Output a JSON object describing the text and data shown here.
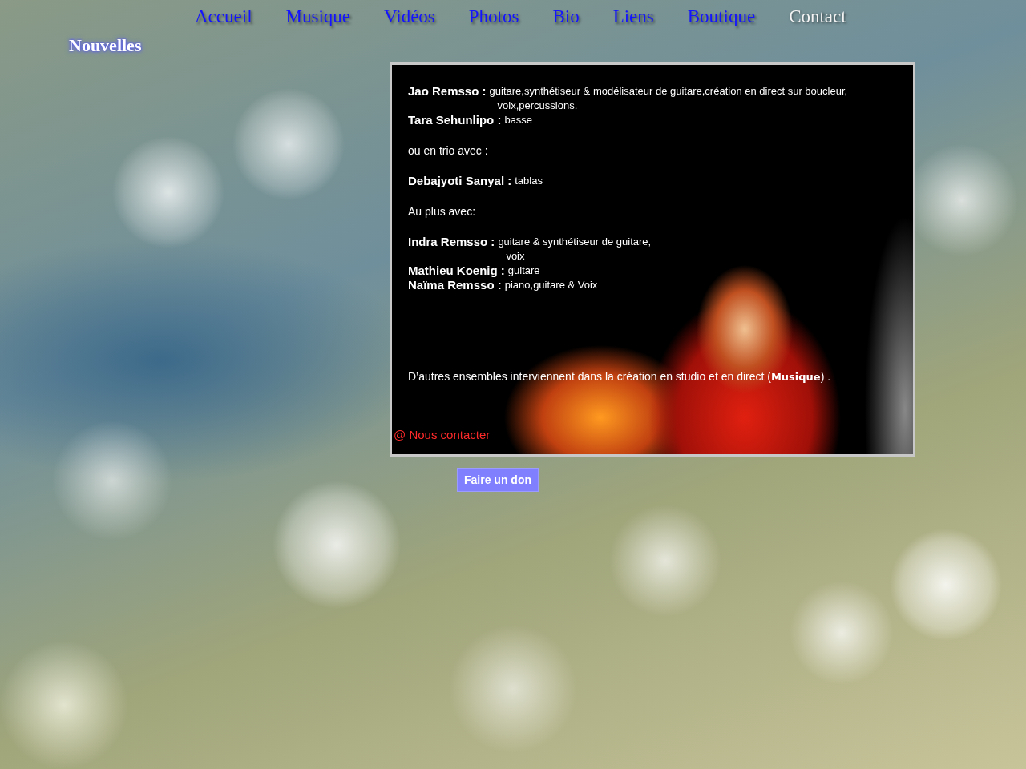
{
  "nav": [
    {
      "label": "Accueil",
      "selected": false
    },
    {
      "label": "Musique",
      "selected": false
    },
    {
      "label": "Vidéos",
      "selected": false
    },
    {
      "label": "Photos",
      "selected": false
    },
    {
      "label": "Bio",
      "selected": false
    },
    {
      "label": "Liens",
      "selected": false
    },
    {
      "label": "Boutique",
      "selected": false
    },
    {
      "label": "Contact",
      "selected": true
    }
  ],
  "heading": "Nouvelles",
  "card": {
    "blocks": [
      {
        "kind": "member",
        "name": "Jao Remsso :",
        "role_lines": [
          "guitare,synthétiseur &  modélisateur de guitare,création en direct sur boucleur,",
          "voix,percussions."
        ]
      },
      {
        "kind": "member",
        "name": "Tara Sehunlipo :",
        "role_lines": [
          "basse"
        ]
      },
      {
        "kind": "text",
        "text": "ou en trio avec :"
      },
      {
        "kind": "member",
        "name": "Debajyoti Sanyal :",
        "role_lines": [
          "tablas"
        ]
      },
      {
        "kind": "text",
        "text": "Au plus avec:"
      },
      {
        "kind": "member",
        "name": "Indra Remsso :",
        "role_lines": [
          "guitare & synthétiseur de guitare,",
          "voix"
        ]
      },
      {
        "kind": "member",
        "name": "Mathieu Koenig :",
        "role_lines": [
          "guitare"
        ]
      },
      {
        "kind": "member",
        "name": "Naïma Remsso :",
        "role_lines": [
          "piano,guitare & Voix"
        ]
      },
      {
        "kind": "note",
        "text": "D’autres ensembles interviennent  dans la création en studio et en direct  (**Musique**) ."
      }
    ],
    "contact_link": {
      "icon": "@",
      "label": "Nous contacter"
    }
  },
  "donate_button": "Faire un don"
}
